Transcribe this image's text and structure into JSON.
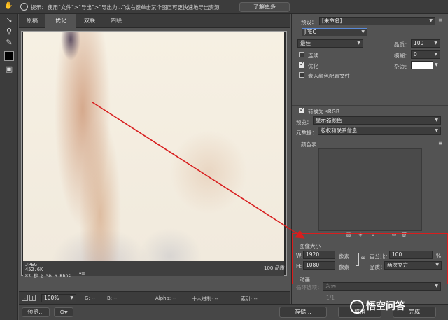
{
  "tip": {
    "label": "提示：",
    "text": "使用“文件”>“导出”>“导出为...”或右键单击某个图层可更快速地导出资源",
    "learn_more": "了解更多"
  },
  "tabs": [
    {
      "label": "原稿",
      "active": false
    },
    {
      "label": "优化",
      "active": true
    },
    {
      "label": "双联",
      "active": false
    },
    {
      "label": "四联",
      "active": false
    }
  ],
  "image_info": {
    "format": "JPEG",
    "size": "452.6K",
    "time": "83 秒 @ 56.6 Kbps",
    "menu_icon": "▾≡",
    "quality": "100 品质"
  },
  "status": {
    "zoom": "100%",
    "g": "G: --",
    "b": "B: --",
    "alpha": "Alpha: --",
    "hex": "十六进制: --",
    "index": "索引: --"
  },
  "bottom": {
    "preview": "预览...",
    "save": "存储...",
    "cancel": "取消",
    "done": "完成",
    "page": "1/1"
  },
  "panel": {
    "preset_label": "预设：",
    "preset_value": "[未命名]",
    "format_value": "JPEG",
    "quality_preset": "最佳",
    "quality_label": "品质：",
    "quality_value": "100",
    "progressive_label": "连续",
    "progressive_checked": false,
    "blur_label": "模糊：",
    "blur_value": "0",
    "optimized_label": "优化",
    "optimized_checked": true,
    "matte_label": "杂边：",
    "matte_color": "#ffffff",
    "icc_label": "嵌入颜色配置文件",
    "icc_checked": false,
    "srgb_label": "转换为 sRGB",
    "srgb_checked": true,
    "preview_label": "预览：",
    "preview_value": "显示器颜色",
    "metadata_label": "元数据：",
    "metadata_value": "版权和联系信息",
    "color_table_label": "颜色表",
    "image_size_label": "图像大小",
    "w_label": "W:",
    "w_value": "1920",
    "w_unit": "像素",
    "h_label": "H:",
    "h_value": "1080",
    "h_unit": "像素",
    "percent_label": "百分比：",
    "percent_value": "100",
    "percent_unit": "%",
    "resample_label": "品质：",
    "resample_value": "两次立方",
    "animation_label": "动画",
    "loop_label": "循环选项：",
    "loop_value": "永远"
  },
  "watermark": "悟空问答",
  "colors": {
    "highlight": "#d81e1e",
    "arrow": "#d81e1e"
  }
}
